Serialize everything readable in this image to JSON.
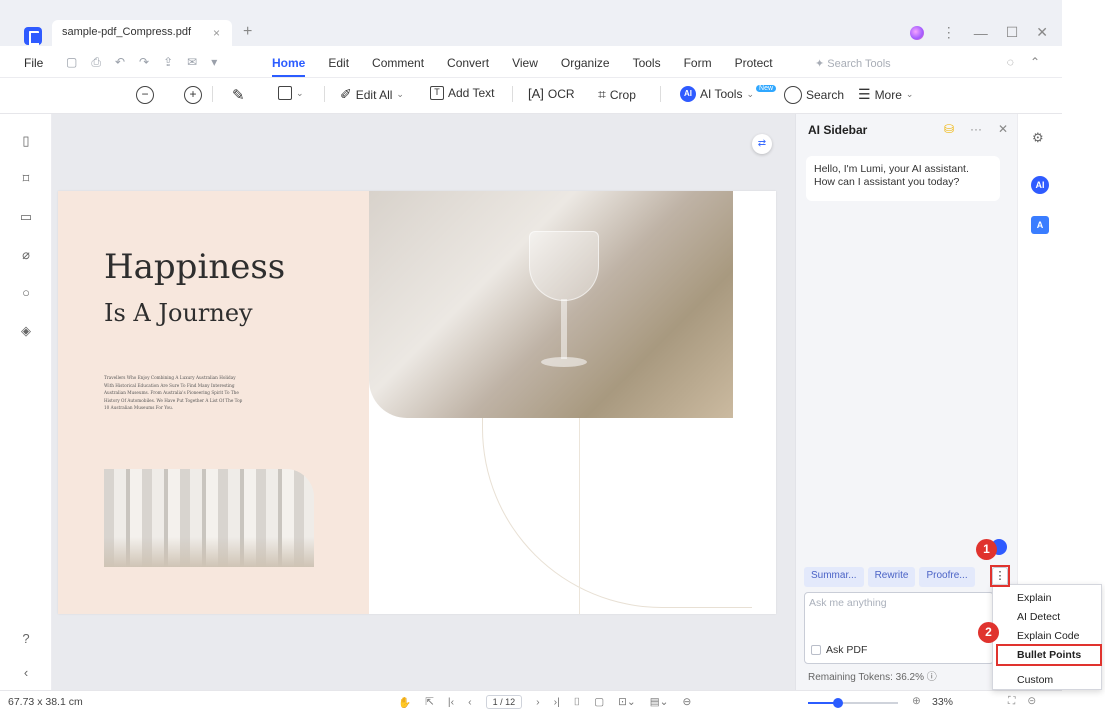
{
  "window": {
    "tab_title": "sample-pdf_Compress.pdf",
    "tab_close": "×",
    "tab_add": "+",
    "controls": {
      "more": "⋮",
      "minimize": "—",
      "maximize": "☐",
      "close": "✕"
    }
  },
  "menubar": {
    "file": "File",
    "items": [
      "Home",
      "Edit",
      "Comment",
      "Convert",
      "View",
      "Organize",
      "Tools",
      "Form",
      "Protect"
    ],
    "active": "Home",
    "search_tools": "Search Tools"
  },
  "toolbar": {
    "edit_all": "Edit All",
    "add_text": "Add Text",
    "ocr": "OCR",
    "crop": "Crop",
    "ai_tools": "AI Tools",
    "ai_badge": "AI",
    "new_badge": "New",
    "search": "Search",
    "more": "More"
  },
  "document": {
    "title": "Happiness",
    "subtitle": "Is A Journey",
    "body": "Travellers Who Enjoy Combining A Luxury Australian Holiday With Historical Education Are Sure To Find Many Interesting Australian Museums. From Australia's Pioneering Spirit To The History Of Automobiles. We Have Put Together A List Of The Top 10 Australian Museums For You."
  },
  "ai_sidebar": {
    "title": "AI Sidebar",
    "greeting": "Hello, I'm Lumi, your AI assistant. How can I assistant you today?",
    "chips": [
      "Summar...",
      "Rewrite",
      "Proofre..."
    ],
    "chip_more": "⋮",
    "ask_placeholder": "Ask me anything",
    "ask_pdf": "Ask PDF",
    "tokens": "Remaining Tokens: 36.2%"
  },
  "dropdown": {
    "items": [
      "Explain",
      "AI Detect",
      "Explain Code",
      "Bullet Points",
      "Custom"
    ],
    "highlighted": "Bullet Points"
  },
  "annotations": {
    "badge1": "1",
    "badge2": "2"
  },
  "statusbar": {
    "size": "67.73 x 38.1 cm",
    "page": "1 / 12",
    "zoom": "33%",
    "zoom_level": 0.33
  },
  "colors": {
    "accent": "#2b5cff",
    "annotation": "#e0332e",
    "page_left": "#f7e7dd"
  }
}
